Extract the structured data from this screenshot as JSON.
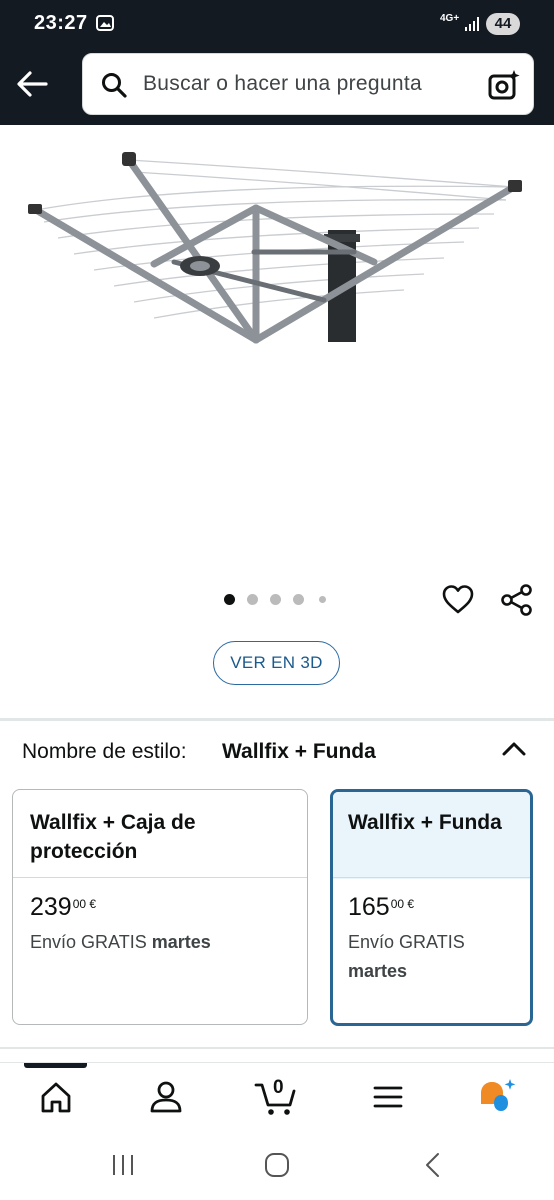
{
  "status_bar": {
    "time": "23:27",
    "network": "4G+",
    "battery": "44"
  },
  "search": {
    "placeholder": "Buscar o hacer una pregunta"
  },
  "carousel": {
    "dot_count": 5,
    "active_index": 0
  },
  "view_3d_label": "VER EN 3D",
  "style_selector": {
    "label": "Nombre de estilo:",
    "selected_value": "Wallfix + Funda",
    "options": [
      {
        "title": "Wallfix + Caja de protección",
        "price_whole": "239",
        "price_cents": "00",
        "currency": "€",
        "shipping_prefix": "Envío GRATIS",
        "shipping_day": "martes",
        "selected": false
      },
      {
        "title": "Wallfix + Funda",
        "price_whole": "165",
        "price_cents": "00",
        "currency": "€",
        "shipping_prefix": "Envío GRATIS",
        "shipping_day": "martes",
        "selected": true
      }
    ]
  },
  "bottom_nav": {
    "cart_count": "0",
    "items": [
      "home-icon",
      "account-icon",
      "cart-icon",
      "menu-icon",
      "rufus-ai-icon"
    ]
  },
  "colors": {
    "header_bg": "#131a22",
    "selected_border": "#2a6694",
    "selected_bg": "#eaf4fb",
    "link_blue": "#1a5a8c",
    "rufus_orange": "#f08a24",
    "rufus_blue": "#1f8fe0"
  }
}
